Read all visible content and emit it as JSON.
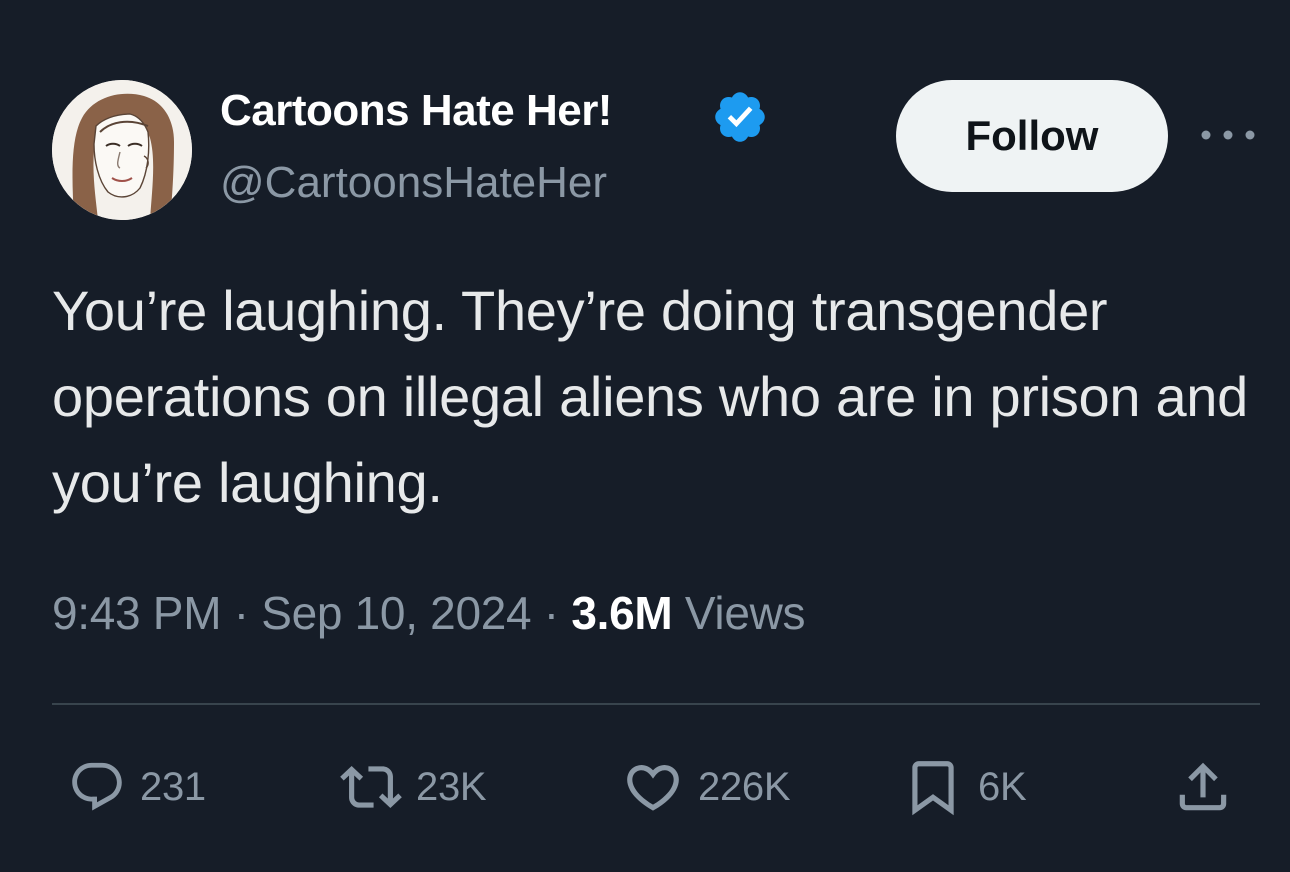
{
  "author": {
    "name": "Cartoons Hate Her!",
    "handle": "@CartoonsHateHer",
    "verified": true,
    "avatar_icon": "cartoon-woman-portrait"
  },
  "follow_button": {
    "label": "Follow"
  },
  "more_menu": {
    "icon": "ellipsis-icon"
  },
  "tweet": {
    "text": "You’re laughing. They’re doing transgender operations on illegal aliens who are in prison and you’re laughing.",
    "time": "9:43 PM",
    "separator": "·",
    "date": "Sep 10, 2024",
    "views_count": "3.6M",
    "views_label": "Views"
  },
  "actions": {
    "reply": {
      "icon": "reply-icon",
      "count": "231"
    },
    "retweet": {
      "icon": "retweet-icon",
      "count": "23K"
    },
    "like": {
      "icon": "heart-icon",
      "count": "226K"
    },
    "bookmark": {
      "icon": "bookmark-icon",
      "count": "6K"
    },
    "share": {
      "icon": "share-icon"
    }
  },
  "colors": {
    "background": "#161d28",
    "text_primary": "#e7e9ea",
    "text_secondary": "#8b98a5",
    "verified_blue": "#1d9bf0",
    "follow_bg": "#eff3f4",
    "divider": "#38444d"
  }
}
